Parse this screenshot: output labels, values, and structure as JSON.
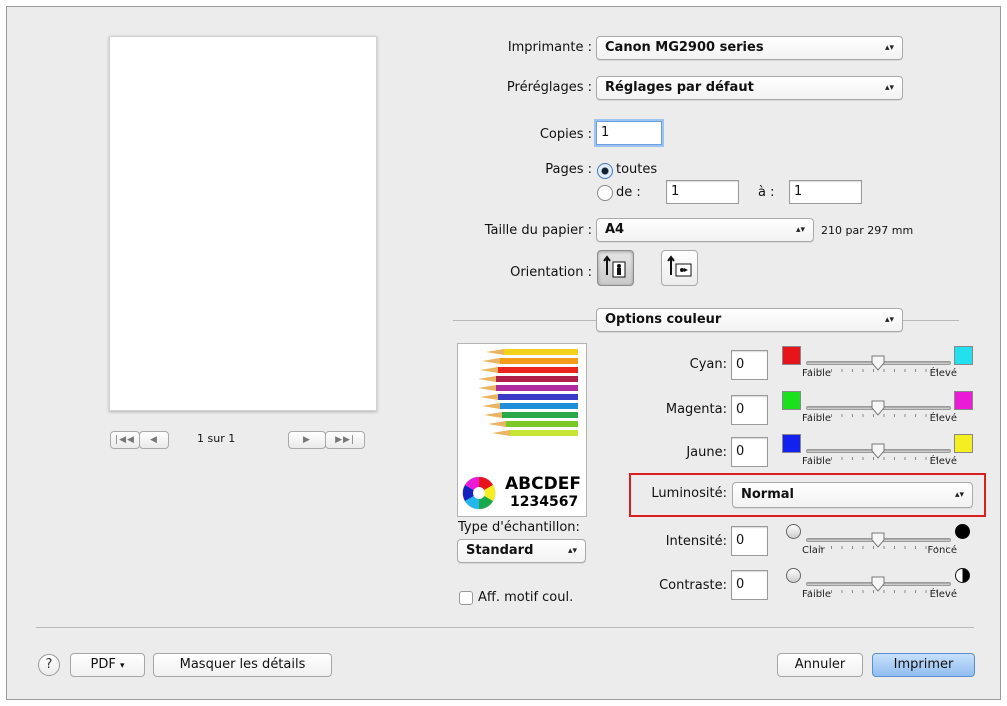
{
  "preview": {
    "page_counter": "1 sur 1",
    "nav_first": "|◀◀",
    "nav_prev": "◀",
    "nav_next": "▶",
    "nav_last": "▶▶|"
  },
  "printer": {
    "label": "Imprimante :",
    "value": "Canon MG2900 series"
  },
  "presets": {
    "label": "Préréglages :",
    "value": "Réglages par défaut"
  },
  "copies": {
    "label": "Copies :",
    "value": "1"
  },
  "pages": {
    "label": "Pages :",
    "all_label": "toutes",
    "from_label": "de :",
    "from_value": "1",
    "to_label": "à :",
    "to_value": "1",
    "selected": "toutes"
  },
  "paper": {
    "label": "Taille du papier :",
    "value": "A4",
    "size_text": "210 par 297 mm"
  },
  "orientation": {
    "label": "Orientation :",
    "selected": "portrait",
    "portrait_icon": "portrait-orientation-icon",
    "landscape_icon": "landscape-orientation-icon"
  },
  "section": {
    "value": "Options couleur"
  },
  "sample": {
    "text_line1": "ABCDEF",
    "text_line2": "1234567",
    "type_label": "Type d'échantillon:",
    "type_value": "Standard",
    "pattern_label": "Aff. motif coul.",
    "pattern_checked": false
  },
  "sliders": {
    "cyan": {
      "label": "Cyan:",
      "value": "0",
      "low": "Faible",
      "high": "Élevé",
      "low_color": "#e8141b",
      "high_color": "#22e0ee",
      "level": 0.5
    },
    "magenta": {
      "label": "Magenta:",
      "value": "0",
      "low": "Faible",
      "high": "Élevé",
      "low_color": "#19e21c",
      "high_color": "#ea1ad6",
      "level": 0.5
    },
    "jaune": {
      "label": "Jaune:",
      "value": "0",
      "low": "Faible",
      "high": "Élevé",
      "low_color": "#1321f0",
      "high_color": "#f5ee21",
      "level": 0.5
    },
    "intensite": {
      "label": "Intensité:",
      "value": "0",
      "low": "Clair",
      "high": "Foncé",
      "level": 0.5
    },
    "contraste": {
      "label": "Contraste:",
      "value": "0",
      "low": "Faible",
      "high": "Élevé",
      "level": 0.5
    }
  },
  "brightness": {
    "label": "Luminosité:",
    "value": "Normal",
    "highlight_color": "#d92020"
  },
  "footer": {
    "help": "?",
    "pdf": "PDF",
    "hide_details": "Masquer les détails",
    "cancel": "Annuler",
    "print": "Imprimer"
  },
  "colors": {
    "accent_button": "#9cc3f2",
    "dialog_bg": "#ececec"
  }
}
